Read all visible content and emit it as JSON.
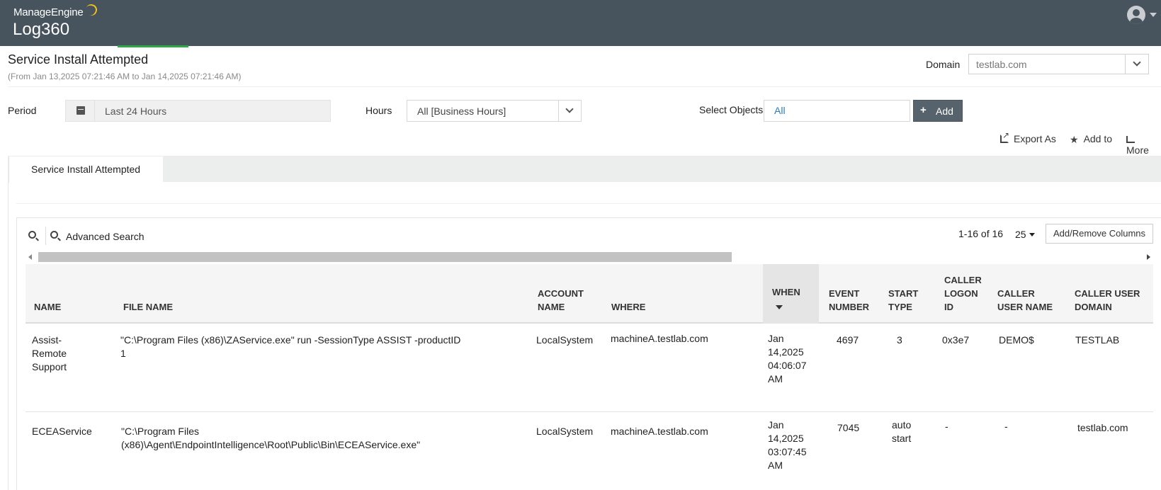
{
  "header": {
    "brand_top": "ManageEngine",
    "brand_main": "Log360"
  },
  "page": {
    "title": "Service Install Attempted",
    "subtitle": "(From Jan 13,2025 07:21:46 AM to Jan 14,2025 07:21:46 AM)"
  },
  "domain": {
    "label": "Domain",
    "value": "testlab.com"
  },
  "filters": {
    "period_label": "Period",
    "period_value": "Last 24 Hours",
    "hours_label": "Hours",
    "hours_value": "All [Business Hours]",
    "objects_label": "Select Objects",
    "objects_value": "All",
    "add_label": "Add"
  },
  "actions": {
    "export": "Export As",
    "add_to": "Add to",
    "more": "More"
  },
  "tab": {
    "label": "Service Install Attempted"
  },
  "toolbar": {
    "advanced_search": "Advanced Search",
    "pager": "1-16 of 16",
    "per_page": "25",
    "add_remove_columns": "Add/Remove Columns"
  },
  "table": {
    "columns": {
      "name": "NAME",
      "file_name": "FILE NAME",
      "account_name": [
        "ACCOUNT",
        "NAME"
      ],
      "where": "WHERE",
      "when": "WHEN",
      "event_number": [
        "EVENT",
        "NUMBER"
      ],
      "start_type": [
        "START",
        "TYPE"
      ],
      "caller_logon_id": [
        "CALLER",
        "LOGON",
        "ID"
      ],
      "caller_user_name": [
        "CALLER",
        "USER NAME"
      ],
      "caller_user_domain": [
        "CALLER USER",
        "DOMAIN"
      ]
    },
    "rows": [
      {
        "name": [
          "Assist-",
          "Remote",
          "Support"
        ],
        "file_name": [
          "\"C:\\Program Files (x86)\\ZAService.exe\" run -SessionType ASSIST -productID",
          "1"
        ],
        "account_name": "LocalSystem",
        "where": "machineA.testlab.com",
        "when": [
          "Jan",
          "14,2025",
          "04:06:07",
          "AM"
        ],
        "event_number": "4697",
        "start_type": [
          "3"
        ],
        "caller_logon_id": "0x3e7",
        "caller_user_name": "DEMO$",
        "caller_user_domain": "TESTLAB"
      },
      {
        "name": [
          "ECEAService"
        ],
        "file_name": [
          "\"C:\\Program Files",
          "(x86)\\Agent\\EndpointIntelligence\\Root\\Public\\Bin\\ECEAService.exe\""
        ],
        "account_name": "LocalSystem",
        "where": "machineA.testlab.com",
        "when": [
          "Jan",
          "14,2025",
          "03:07:45",
          "AM"
        ],
        "event_number": "7045",
        "start_type": [
          "auto",
          "start"
        ],
        "caller_logon_id": "-",
        "caller_user_name": "-",
        "caller_user_domain": "testlab.com"
      }
    ]
  }
}
